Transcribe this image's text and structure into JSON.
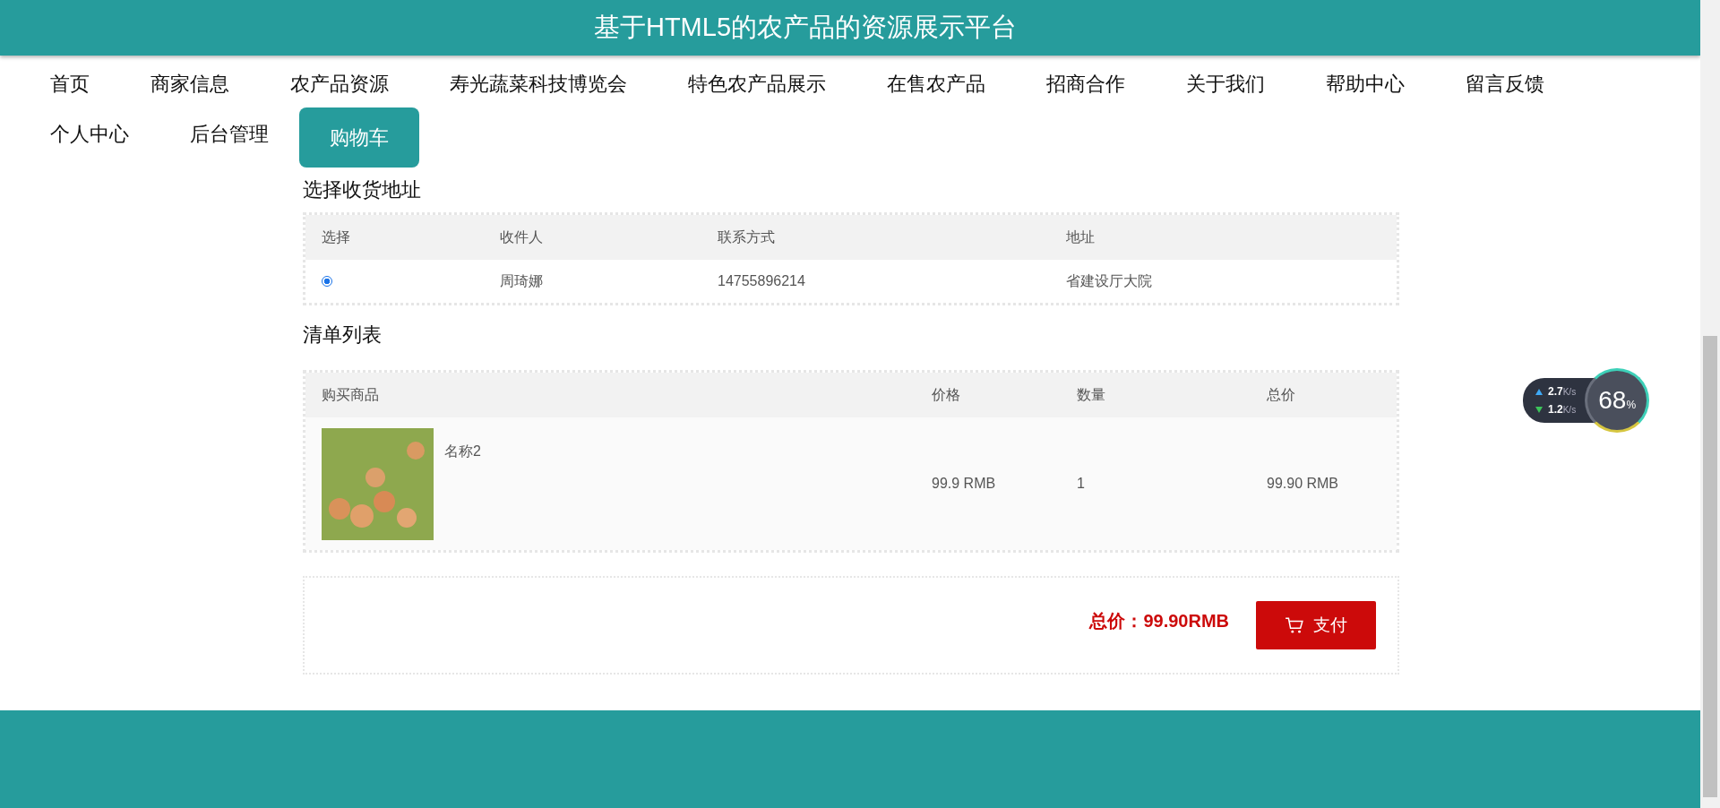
{
  "header": {
    "title": "基于HTML5的农产品的资源展示平台"
  },
  "nav": [
    {
      "label": "首页",
      "selected": false
    },
    {
      "label": "商家信息",
      "selected": false
    },
    {
      "label": "农产品资源",
      "selected": false
    },
    {
      "label": "寿光蔬菜科技博览会",
      "selected": false
    },
    {
      "label": "特色农产品展示",
      "selected": false
    },
    {
      "label": "在售农产品",
      "selected": false
    },
    {
      "label": "招商合作",
      "selected": false
    },
    {
      "label": "关于我们",
      "selected": false
    },
    {
      "label": "帮助中心",
      "selected": false
    },
    {
      "label": "留言反馈",
      "selected": false
    },
    {
      "label": "个人中心",
      "selected": false
    },
    {
      "label": "后台管理",
      "selected": false
    },
    {
      "label": "购物车",
      "selected": true
    }
  ],
  "address": {
    "title": "选择收货地址",
    "columns": [
      "选择",
      "收件人",
      "联系方式",
      "地址"
    ],
    "rows": [
      {
        "selected": true,
        "name": "周琦娜",
        "phone": "14755896214",
        "address": "省建设厅大院"
      }
    ]
  },
  "order": {
    "title": "清单列表",
    "columns": [
      "购买商品",
      "价格",
      "数量",
      "总价"
    ],
    "rows": [
      {
        "name": "名称2",
        "price": "99.9 RMB",
        "quantity": "1",
        "total": "99.90 RMB"
      }
    ]
  },
  "summary": {
    "total": "总价：99.90RMB",
    "pay_button": "支付"
  },
  "speed_widget": {
    "upload": "2.7",
    "upload_unit": "K/s",
    "download": "1.2",
    "download_unit": "K/s",
    "percent": "68",
    "percent_unit": "%"
  }
}
